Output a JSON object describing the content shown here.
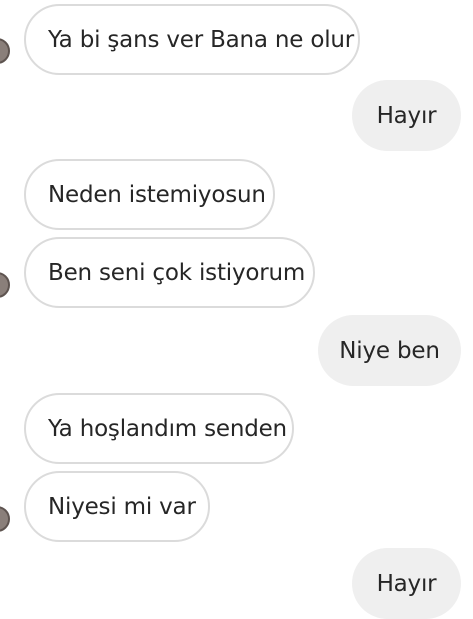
{
  "messages": [
    {
      "direction": "incoming",
      "text": "Ya bi şans ver Bana ne olur"
    },
    {
      "direction": "outgoing",
      "text": "Hayır"
    },
    {
      "direction": "incoming",
      "text": "Neden istemiyosun"
    },
    {
      "direction": "incoming",
      "text": "Ben seni çok istiyorum"
    },
    {
      "direction": "outgoing",
      "text": "Niye ben"
    },
    {
      "direction": "incoming",
      "text": "Ya hoşlandım senden"
    },
    {
      "direction": "incoming",
      "text": "Niyesi mi var"
    },
    {
      "direction": "outgoing",
      "text": "Hayır"
    }
  ],
  "colors": {
    "incoming_bubble_bg": "#ffffff",
    "incoming_bubble_border": "#dbdbdb",
    "outgoing_bubble_bg": "#efefef",
    "text": "#262626"
  }
}
